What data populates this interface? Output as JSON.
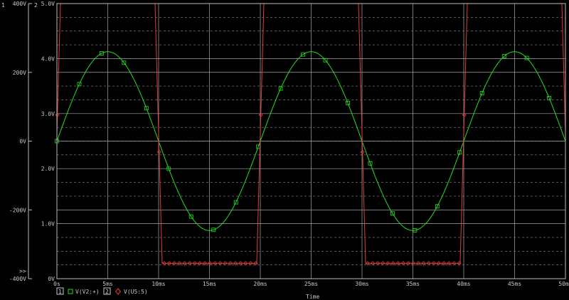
{
  "chart_data": {
    "type": "line",
    "title": "",
    "xlabel": "Time",
    "x_range_ms": [
      0,
      50
    ],
    "x_ticks": [
      "0s",
      "5ms",
      "10ms",
      "15ms",
      "20ms",
      "25ms",
      "30ms",
      "35ms",
      "40ms",
      "45ms",
      "50ms"
    ],
    "axis1": {
      "id": "1",
      "unit": "V",
      "range": [
        -400,
        400
      ],
      "ticks": [
        "400V",
        "200V",
        "0V",
        "-200V",
        "-400V"
      ]
    },
    "axis2": {
      "id": "2",
      "unit": "V",
      "range": [
        0,
        5
      ],
      "ticks": [
        "5.0V",
        "4.0V",
        "3.0V",
        "2.0V",
        "1.0V",
        "0V"
      ]
    },
    "scroll_marker": ">>",
    "series": [
      {
        "name": "V(V2:+)",
        "axis": "1",
        "color": "#22dd22",
        "marker": "square",
        "function": "sine",
        "amplitude": 260,
        "offset": 0,
        "period_ms": 20
      },
      {
        "name": "V(U5:5)",
        "axis": "2",
        "color": "#e03c3c",
        "marker": "diamond",
        "function": "square_wave",
        "high": 5.0,
        "low": 0.28,
        "period_ms": 20
      }
    ],
    "legend": [
      {
        "index": "1",
        "label": "V(V2:+)"
      },
      {
        "index": "2",
        "label": "V(U5:5)"
      }
    ],
    "grid": true
  }
}
